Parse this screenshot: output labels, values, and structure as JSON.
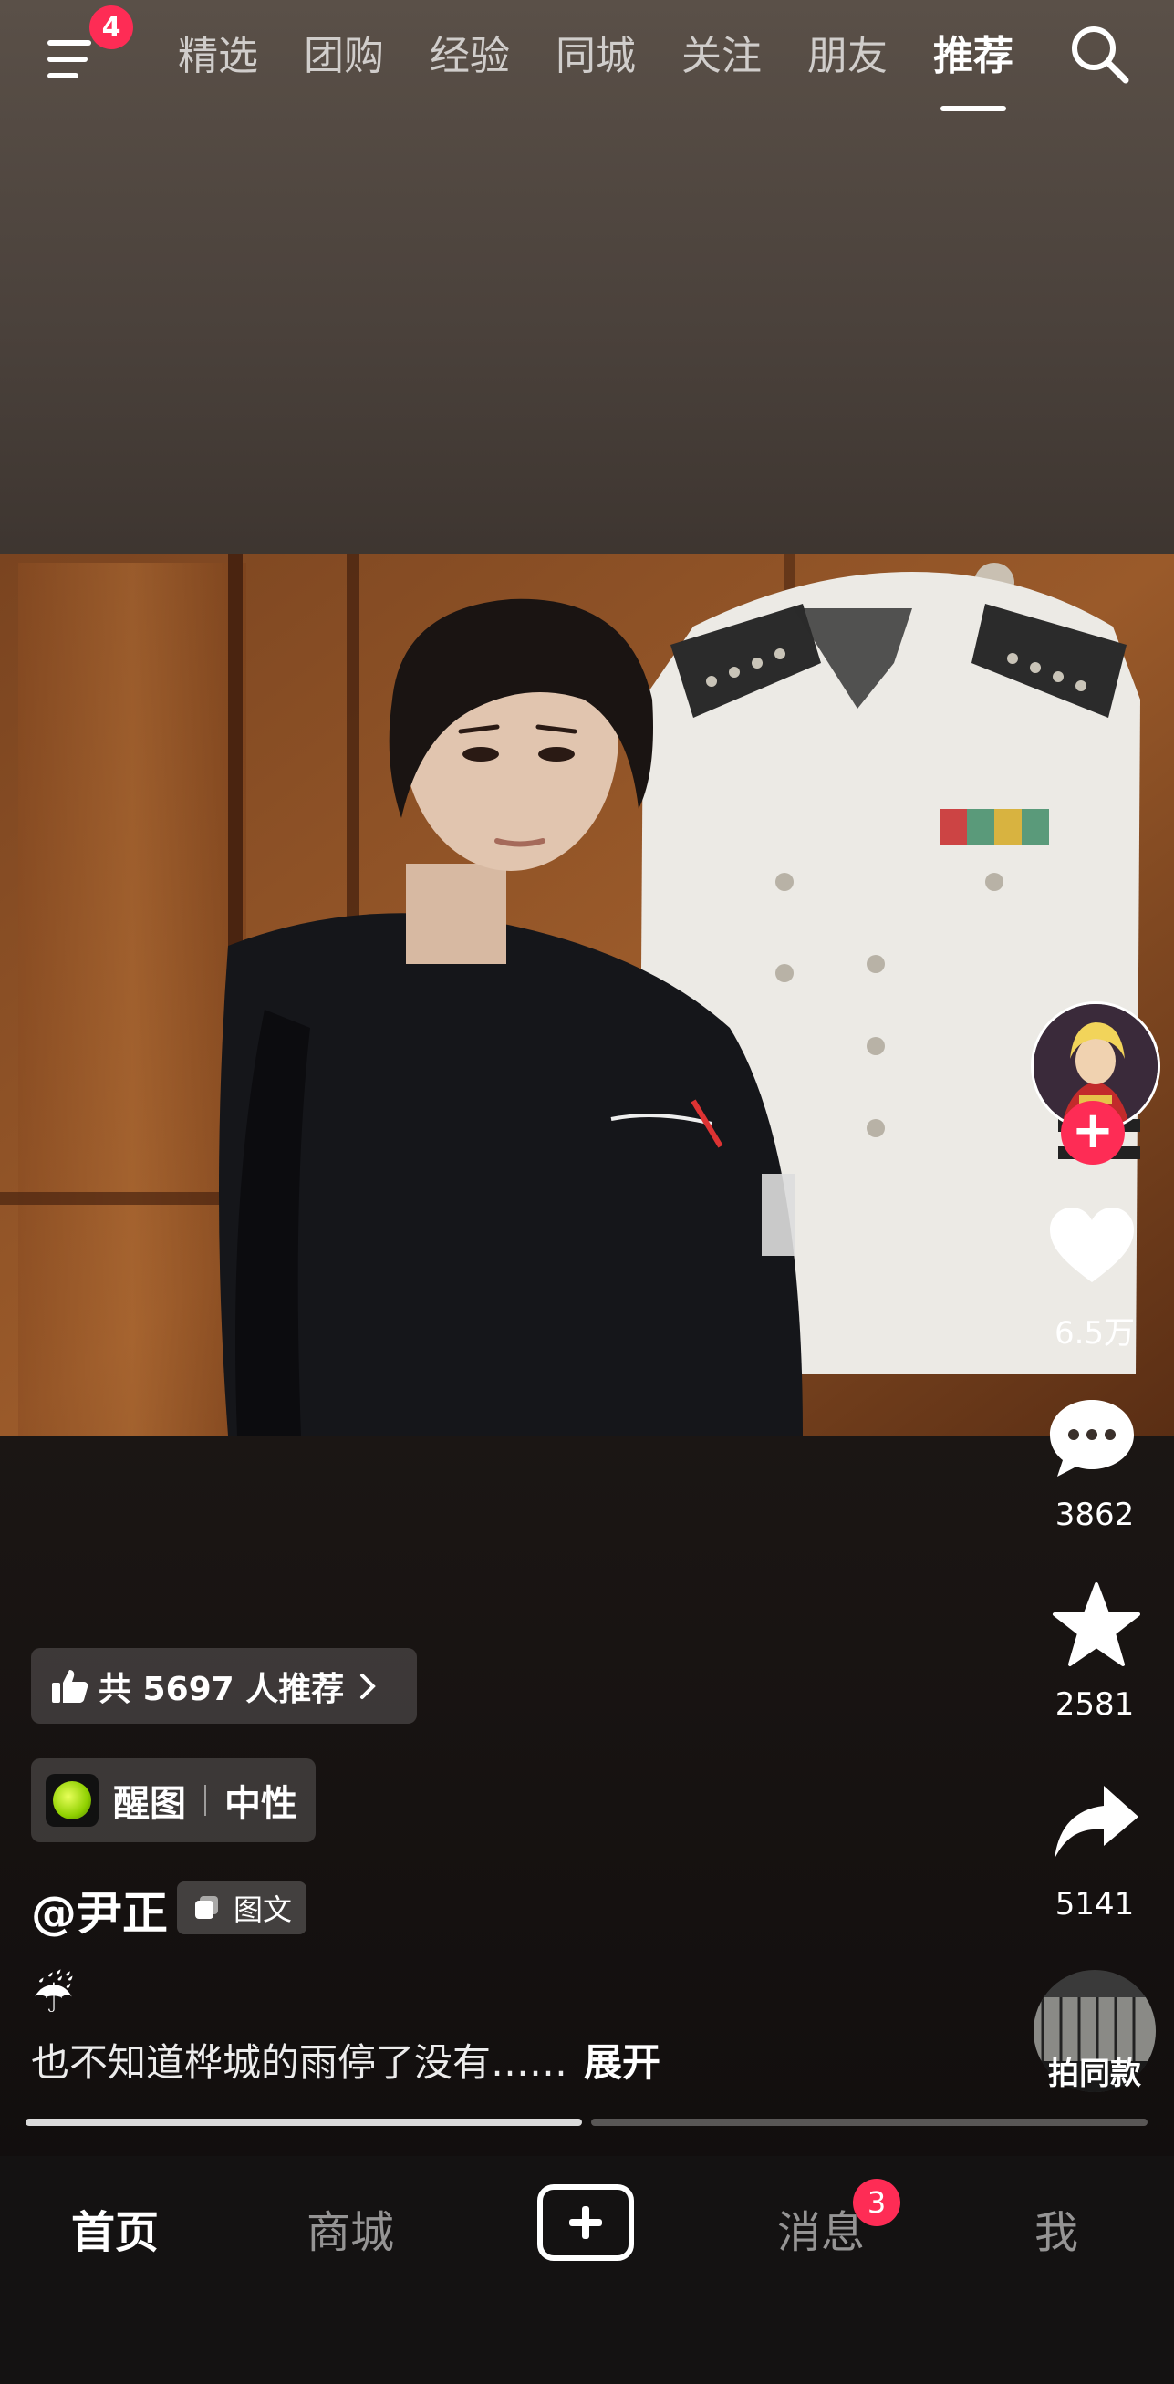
{
  "top_nav": {
    "menu_badge": "4",
    "tabs": [
      "精选",
      "团购",
      "经验",
      "同城",
      "关注",
      "朋友",
      "推荐"
    ],
    "active_tab": "推荐"
  },
  "post": {
    "avatar_icon": "creator-avatar",
    "likes": "6.5万",
    "comments": "3862",
    "favorites": "2581",
    "shares": "5141",
    "recommend_text": "共 5697 人推荐",
    "app_name": "醒图",
    "app_tag": "中性",
    "author": "@尹正",
    "post_type": "图文",
    "emoji": "☔",
    "caption": "也不知道桦城的雨停了没有……",
    "expand_label": "展开",
    "same_style_label": "拍同款",
    "images_total": 2,
    "current_image_index": 1
  },
  "bottom_tabs": {
    "home": "首页",
    "mall": "商城",
    "create_icon": "plus-icon",
    "messages": "消息",
    "messages_badge": "3",
    "me": "我",
    "active": "首页"
  },
  "colors": {
    "badge_red": "#fe2c55",
    "text_white": "#ffffff"
  }
}
